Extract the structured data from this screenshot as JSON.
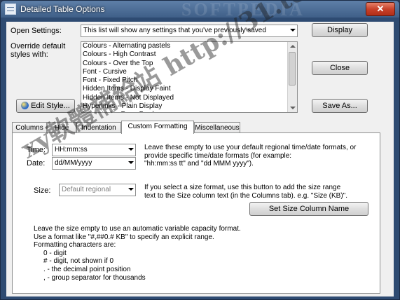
{
  "window": {
    "title": "Detailed Table Options",
    "close_label": "✕",
    "watermark_top": "SOFTPEDIA",
    "watermark_diag": "xy軟體補給站 http://31.to"
  },
  "open_settings": {
    "label": "Open Settings:",
    "value": "This list will show any settings that you've previously saved",
    "display_button": "Display"
  },
  "override": {
    "label_line1": "Override default",
    "label_line2": "styles with:",
    "items": [
      "Colours - Alternating pastels",
      "Colours - High Contrast",
      "Colours - Over the Top",
      "Font - Cursive",
      "Font - Fixed Pitch",
      "Hidden Items - Display Faint",
      "Hidden Items - Not Displayed",
      "Hyperlinks - Plain Display",
      "Layout - No Page Border"
    ],
    "close_button": "Close",
    "edit_style_button": "Edit Style...",
    "save_as_button": "Save As..."
  },
  "tabs": [
    {
      "label": "Columns"
    },
    {
      "label": "Hide"
    },
    {
      "label": "Indentation"
    },
    {
      "label": "Custom Formatting",
      "active": true
    },
    {
      "label": "Miscellaneous"
    }
  ],
  "custom_formatting": {
    "time_label": "Time:",
    "time_value": "HH:mm:ss",
    "date_label": "Date:",
    "date_value": "dd/MM/yyyy",
    "time_date_help": [
      "Leave these empty to use your default regional time/date formats, or",
      "provide specific time/date formats (for example:",
      "\"hh:mm:ss tt\" and \"dd MMM yyyy\")."
    ],
    "size_label": "Size:",
    "size_value": "Default regional",
    "size_help": [
      "If you select a size format, use this button to add the size range",
      "text to the Size column text (in the Columns tab).  e.g.   \"Size (KB)\"."
    ],
    "set_size_button": "Set Size Column Name",
    "size_notes": [
      "Leave the size empty to use an automatic variable capacity format.",
      "Use a format like \"#,##0.# KB\" to specify an explicit range.",
      "Formatting characters are:",
      "0 - digit",
      "# - digit, not shown if 0",
      ". - the decimal point position",
      ", - group separator for thousands"
    ]
  }
}
